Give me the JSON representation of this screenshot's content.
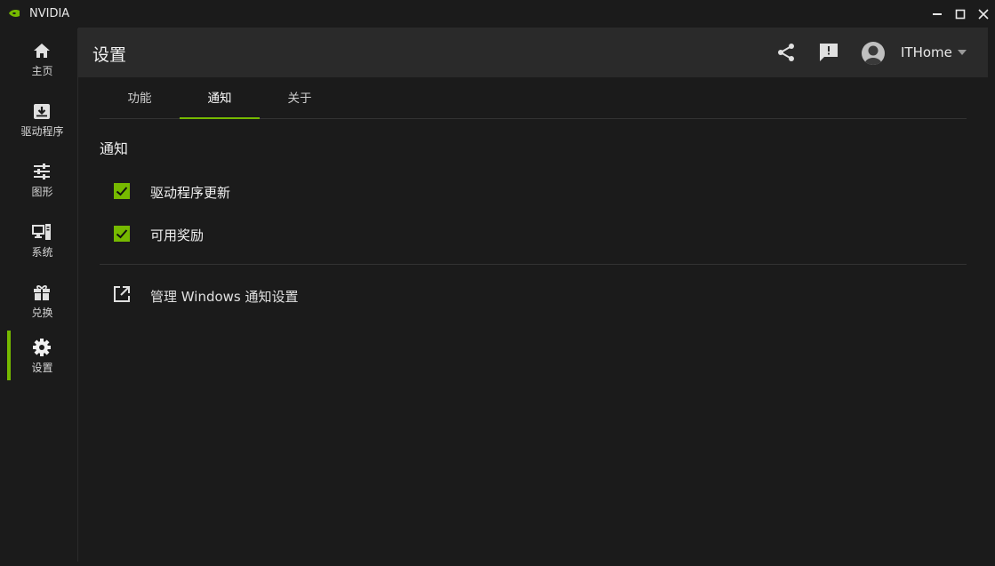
{
  "window": {
    "title": "NVIDIA",
    "controls": [
      "minimize-icon",
      "maximize-icon",
      "close-icon"
    ]
  },
  "sidebar": {
    "items": [
      {
        "label": "主页",
        "icon": "home-icon"
      },
      {
        "label": "驱动程序",
        "icon": "download-drawer-icon"
      },
      {
        "label": "图形",
        "icon": "sliders-icon"
      },
      {
        "label": "系统",
        "icon": "monitor-tower-icon"
      },
      {
        "label": "兑换",
        "icon": "gift-icon"
      },
      {
        "label": "设置",
        "icon": "gear-icon",
        "active": true
      }
    ]
  },
  "header": {
    "title": "设置",
    "share_icon": "share-icon",
    "feedback_icon": "feedback-icon",
    "user": {
      "name": "ITHome",
      "avatar_icon": "avatar-icon",
      "caret_icon": "caret-down-icon"
    }
  },
  "tabs": [
    {
      "label": "功能",
      "active": false
    },
    {
      "label": "通知",
      "active": true
    },
    {
      "label": "关于",
      "active": false
    }
  ],
  "notifications": {
    "section_title": "通知",
    "options": [
      {
        "label": "驱动程序更新",
        "checked": true
      },
      {
        "label": "可用奖励",
        "checked": true
      }
    ],
    "manage_link": "管理 Windows 通知设置"
  },
  "colors": {
    "accent": "#76b900",
    "background": "#1b1b1b",
    "header": "#2a2a2a"
  }
}
